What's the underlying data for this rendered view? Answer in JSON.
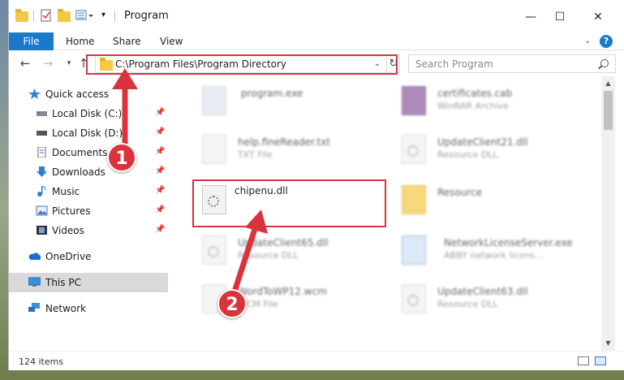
{
  "window": {
    "title": "Program"
  },
  "ribbon": {
    "tabs": [
      "File",
      "Home",
      "Share",
      "View"
    ]
  },
  "window_controls": {
    "minimize": "—",
    "maximize": "☐",
    "close": "✕"
  },
  "nav": {
    "back": "←",
    "forward": "→",
    "up": "↑",
    "address": "C:\\Program Files\\Program Directory",
    "search_placeholder": "Search Program"
  },
  "sidebar": {
    "items": [
      {
        "label": "Quick access",
        "icon": "star-icon",
        "pinned": false
      },
      {
        "label": "Local Disk (C:)",
        "icon": "drive-icon",
        "pinned": true
      },
      {
        "label": "Local Disk (D:)",
        "icon": "drive-icon",
        "pinned": true
      },
      {
        "label": "Documents",
        "icon": "documents-icon",
        "pinned": true
      },
      {
        "label": "Downloads",
        "icon": "downloads-icon",
        "pinned": true
      },
      {
        "label": "Music",
        "icon": "music-icon",
        "pinned": true
      },
      {
        "label": "Pictures",
        "icon": "pictures-icon",
        "pinned": true
      },
      {
        "label": "Videos",
        "icon": "videos-icon",
        "pinned": true
      },
      {
        "label": "OneDrive",
        "icon": "cloud-icon",
        "pinned": false
      },
      {
        "label": "This PC",
        "icon": "computer-icon",
        "pinned": false
      },
      {
        "label": "Network",
        "icon": "network-icon",
        "pinned": false
      }
    ]
  },
  "files": [
    {
      "name": "program.exe",
      "type": ""
    },
    {
      "name": "certificates.cab",
      "type": "WinRAR Archive"
    },
    {
      "name": "help.fineReader.txt",
      "type": "TXT File"
    },
    {
      "name": "UpdateClient21.dll",
      "type": "Resource DLL"
    },
    {
      "name": "chipenu.dll",
      "type": ""
    },
    {
      "name": "Resource",
      "type": ""
    },
    {
      "name": "UpdateClient65.dll",
      "type": "Resource DLL"
    },
    {
      "name": "NetworkLicenseServer.exe",
      "type": "ABBY network licens..."
    },
    {
      "name": "WordToWP12.wcm",
      "type": "WCM File"
    },
    {
      "name": "UpdateClient63.dll",
      "type": "Resource DLL"
    }
  ],
  "status": {
    "item_count": "124 items"
  },
  "annotations": {
    "step1": "1",
    "step2": "2"
  },
  "colors": {
    "accent": "#1979ca",
    "callout": "#d9333c",
    "selected": "#d9d9d9"
  }
}
